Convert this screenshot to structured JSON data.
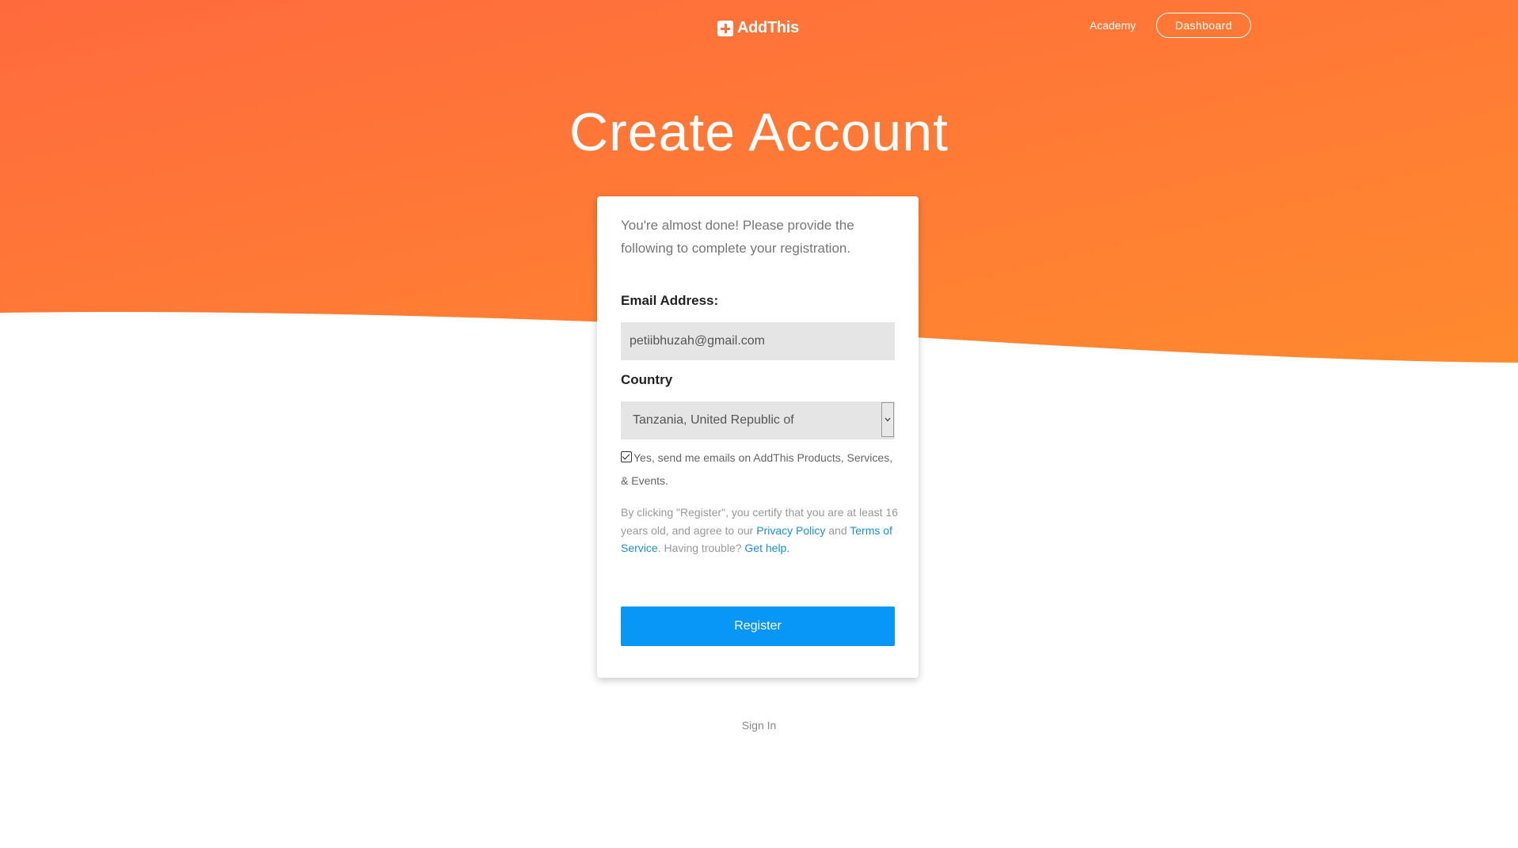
{
  "header": {
    "logo_text": "AddThis",
    "nav_academy": "Academy",
    "nav_dashboard": "Dashboard"
  },
  "colors": {
    "hero_gradient_start": "#ff6a3d",
    "hero_gradient_end": "#ff8a2e",
    "register_button": "#0896f7",
    "link": "#1a8fd8"
  },
  "main": {
    "title": "Create Account",
    "intro": "You're almost done! Please provide the following to complete your registration.",
    "email_label": "Email Address:",
    "email_value": "petiibhuzah@gmail.com",
    "country_label": "Country",
    "country_value": "Tanzania, United Republic of",
    "newsletter_checked": true,
    "newsletter_label": "Yes, send me emails on AddThis Products, Services, & Events.",
    "legal_prefix": "By clicking \"Register\", you certify that you are at least 16 years old, and agree to our",
    "privacy_link": "Privacy Policy",
    "legal_and": "and",
    "terms_link": "Terms of Service",
    "trouble_text": ". Having trouble?",
    "help_link": "Get help",
    "help_suffix": ".",
    "register_label": "Register"
  },
  "footer": {
    "sign_in": "Sign In"
  }
}
